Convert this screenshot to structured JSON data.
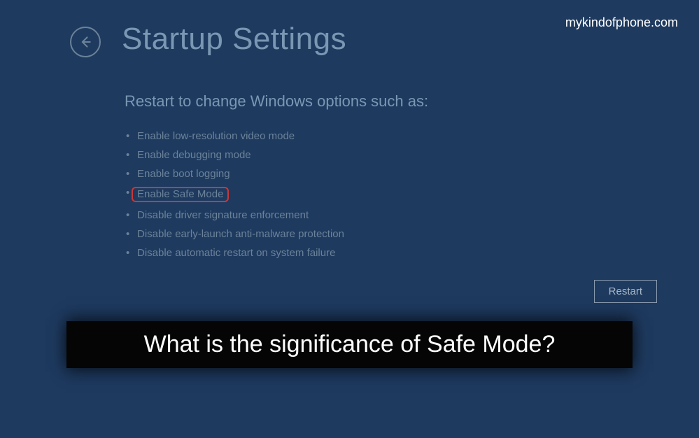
{
  "watermark": "mykindofphone.com",
  "header": {
    "title": "Startup Settings"
  },
  "content": {
    "subtitle": "Restart to change Windows options such as:",
    "options": [
      "Enable low-resolution video mode",
      "Enable debugging mode",
      "Enable boot logging",
      "Enable Safe Mode",
      "Disable driver signature enforcement",
      "Disable early-launch anti-malware protection",
      "Disable automatic restart on system failure"
    ],
    "highlighted_index": 3
  },
  "restart_button": "Restart",
  "caption": "What is the significance of Safe Mode?"
}
